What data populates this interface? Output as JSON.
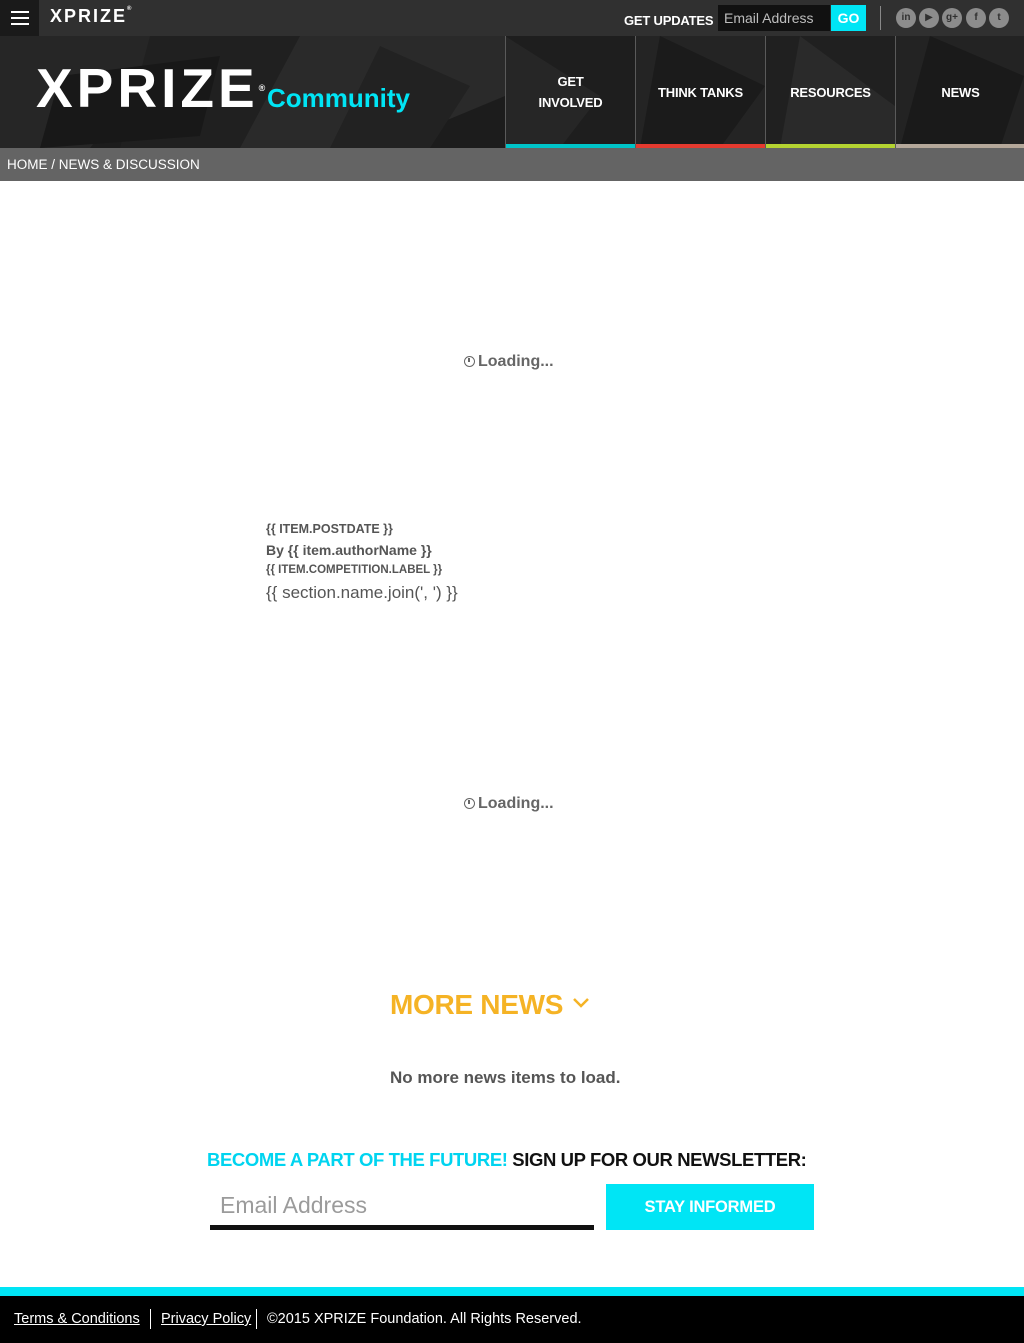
{
  "topbar": {
    "logo": "XPRIZE",
    "get_updates": "GET UPDATES",
    "email_placeholder": "Email Address",
    "go_label": "GO",
    "social": [
      {
        "icon": "linkedin-icon",
        "glyph": "in"
      },
      {
        "icon": "youtube-icon",
        "glyph": "▶"
      },
      {
        "icon": "google-plus-icon",
        "glyph": "g+"
      },
      {
        "icon": "facebook-icon",
        "glyph": "f"
      },
      {
        "icon": "twitter-icon",
        "glyph": "t"
      }
    ]
  },
  "header": {
    "logo": "XPRIZE",
    "subtitle": "Community",
    "nav": [
      {
        "label": "GET INVOLVED",
        "color": "#00c4c8"
      },
      {
        "label": "THINK TANKS",
        "color": "#e53a2f"
      },
      {
        "label": "RESOURCES",
        "color": "#b4d331"
      },
      {
        "label": "NEWS",
        "color": "#b5a89a"
      }
    ]
  },
  "breadcrumb": "HOME / NEWS & DISCUSSION",
  "content": {
    "loading_1": "Loading...",
    "post_date": "{{ ITEM.POSTDATE }}",
    "author": "By {{ item.authorName }}",
    "competition": "{{ ITEM.COMPETITION.LABEL }}",
    "section": "{{ section.name.join(', ') }}",
    "loading_2": "Loading...",
    "more_news": "MORE NEWS",
    "no_more": "No more news items to load."
  },
  "newsletter": {
    "headline_cyan": "BECOME A PART OF THE FUTURE!",
    "headline_black": "SIGN UP FOR OUR NEWSLETTER:",
    "email_placeholder": "Email Address",
    "button": "STAY INFORMED"
  },
  "footer": {
    "terms": "Terms & Conditions",
    "privacy": "Privacy Policy",
    "copyright": "©2015 XPRIZE Foundation. All Rights Reserved."
  },
  "colors": {
    "accent_cyan": "#00e5f5",
    "more_news_orange": "#f5b325"
  }
}
